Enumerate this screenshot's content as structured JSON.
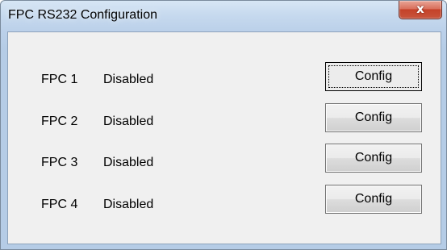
{
  "window": {
    "title": "FPC RS232 Configuration",
    "close_glyph": "x"
  },
  "rows": [
    {
      "name": "FPC 1",
      "status": "Disabled",
      "button": "Config"
    },
    {
      "name": "FPC 2",
      "status": "Disabled",
      "button": "Config"
    },
    {
      "name": "FPC 3",
      "status": "Disabled",
      "button": "Config"
    },
    {
      "name": "FPC 4",
      "status": "Disabled",
      "button": "Config"
    }
  ]
}
